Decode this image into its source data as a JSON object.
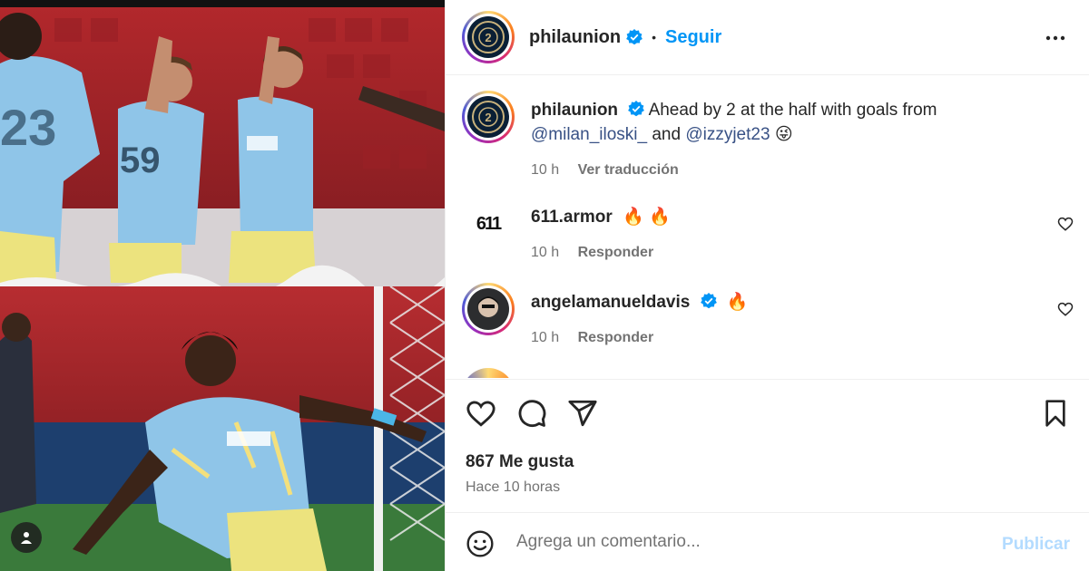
{
  "post": {
    "username": "philaunion",
    "follow_label": "Seguir",
    "dot": "•",
    "caption_text_1": "Ahead by 2 at the half with goals from",
    "mention_1": "@milan_iloski_",
    "caption_and": "and",
    "mention_2": "@izzyjet23",
    "caption_emoji": "😜",
    "caption_time": "10 h",
    "translate_label": "Ver traducción",
    "likes": "867 Me gusta",
    "posted_ago": "Hace 10 horas"
  },
  "comments": [
    {
      "username": "611.armor",
      "text": "🔥 🔥",
      "time": "10 h",
      "reply_label": "Responder",
      "avatar_text": "611"
    },
    {
      "username": "angelamanueldavis",
      "text": "🔥",
      "time": "10 h",
      "reply_label": "Responder"
    }
  ],
  "composer": {
    "placeholder": "Agrega un comentario...",
    "publish_label": "Publicar"
  },
  "colors": {
    "accent": "#0095f6",
    "verified": "#0095f6",
    "muted": "#737373",
    "publish_disabled": "#b3dbff"
  },
  "icons": [
    "verified-badge-icon",
    "more-options-icon",
    "like-icon",
    "comment-icon",
    "share-icon",
    "save-icon",
    "emoji-icon",
    "tag-user-icon",
    "heart-small-icon"
  ]
}
